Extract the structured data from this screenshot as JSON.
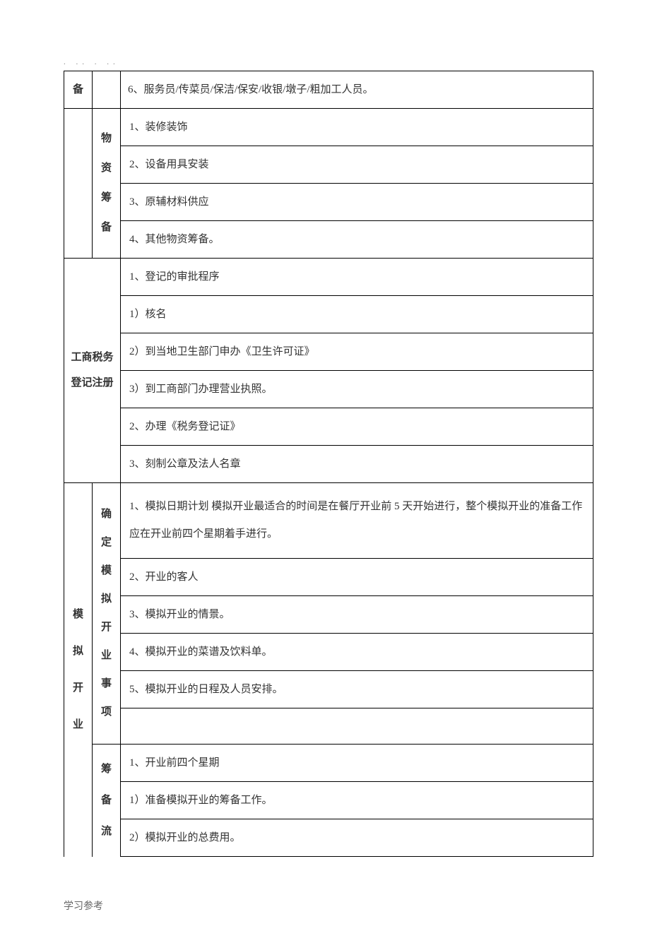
{
  "header_marks": ". .. . ..",
  "row1": {
    "left": "备",
    "content": "6、服务员/传菜员/保洁/保安/收银/墩子/粗加工人员。"
  },
  "row2": {
    "labels": [
      "物",
      "资",
      "筹",
      "备"
    ],
    "items": [
      "1、装修装饰",
      "2、设备用具安装",
      "3、原辅材料供应",
      "4、其他物资筹备。"
    ]
  },
  "row3": {
    "head": "工商税务登记注册",
    "items": [
      "1、登记的审批程序",
      "1）核名",
      "2）到当地卫生部门申办《卫生许可证》",
      "3）到工商部门办理营业执照。",
      "2、办理《税务登记证》",
      "3、刻制公章及法人名章"
    ]
  },
  "row4": {
    "side": [
      "模",
      "拟",
      "开",
      "业"
    ],
    "sub1_labels": [
      "确",
      "定",
      "模",
      "拟",
      "开",
      "业",
      "事",
      "项"
    ],
    "sub1_item1": "1、模拟日期计划 模拟开业最适合的时间是在餐厅开业前 5 天开始进行，整个模拟开业的准备工作应在开业前四个星期着手进行。",
    "sub1_items": [
      "2、开业的客人",
      "3、模拟开业的情景。",
      "4、模拟开业的菜谱及饮料单。",
      "5、模拟开业的日程及人员安排。"
    ],
    "sub2_labels": [
      "筹",
      "备",
      "流"
    ],
    "sub2_items": [
      "1、开业前四个星期",
      "1）准备模拟开业的筹备工作。",
      "2）模拟开业的总费用。"
    ]
  },
  "footer": "学习参考"
}
